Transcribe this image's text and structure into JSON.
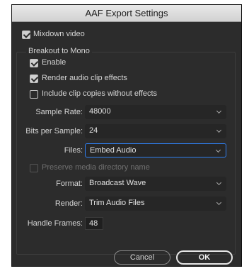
{
  "window": {
    "title": "AAF Export Settings"
  },
  "mixdown_video": {
    "label": "Mixdown video",
    "checked": true
  },
  "breakout": {
    "section_label": "Breakout to Mono",
    "enable": {
      "label": "Enable",
      "checked": true
    },
    "render_effects": {
      "label": "Render audio clip effects",
      "checked": true
    },
    "include_copies": {
      "label": "Include clip copies without effects",
      "checked": false
    }
  },
  "sample_rate": {
    "label": "Sample Rate:",
    "value": "48000"
  },
  "bits_per_sample": {
    "label": "Bits per Sample:",
    "value": "24"
  },
  "files": {
    "label": "Files:",
    "value": "Embed Audio"
  },
  "preserve_dir": {
    "label": "Preserve media directory name",
    "checked": false,
    "enabled": false
  },
  "format": {
    "label": "Format:",
    "value": "Broadcast Wave"
  },
  "render": {
    "label": "Render:",
    "value": "Trim Audio Files"
  },
  "handle_frames": {
    "label": "Handle Frames:",
    "value": "48"
  },
  "buttons": {
    "cancel": "Cancel",
    "ok": "OK"
  },
  "colors": {
    "accent": "#2f7ff0",
    "panel": "#2c2c2c",
    "titlebar": "#dcdcdc"
  }
}
